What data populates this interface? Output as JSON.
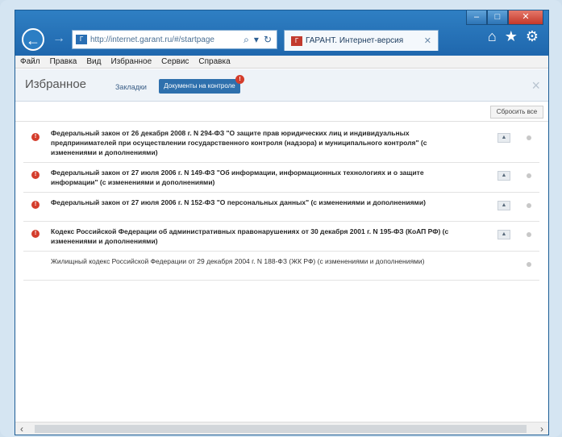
{
  "browser": {
    "address": "http://internet.garant.ru/#/startpage",
    "tab_title": "ГАРАНТ. Интернет-версия",
    "favicon": "garant-icon"
  },
  "menu": [
    "Файл",
    "Правка",
    "Вид",
    "Избранное",
    "Сервис",
    "Справка"
  ],
  "panel": {
    "title": "Избранное",
    "tab_bookmarks": "Закладки",
    "tab_control": "Документы на контроле",
    "badge": "!",
    "close": "×",
    "reset_all": "Сбросить все"
  },
  "documents": [
    {
      "text": "Федеральный закон от 26 декабря 2008 г. N 294-ФЗ \"О защите прав юридических лиц и индивидуальных предпринимателей при осуществлении государственного контроля (надзора) и муниципального контроля\" (с изменениями и дополнениями)",
      "alert": "!"
    },
    {
      "text": "Федеральный закон от 27 июля 2006 г. N 149-ФЗ \"Об информации, информационных технологиях и о защите информации\" (с изменениями и дополнениями)",
      "alert": "!"
    },
    {
      "text": "Федеральный закон от 27 июля 2006 г. N 152-ФЗ \"О персональных данных\" (с изменениями и дополнениями)",
      "alert": "!"
    },
    {
      "text": "Кодекс Российской Федерации об административных правонарушениях от 30 декабря 2001 г. N 195-ФЗ (КоАП РФ) (с изменениями и дополнениями)",
      "alert": "!"
    },
    {
      "text": "Жилищный кодекс Российской Федерации от 29 декабря 2004 г. N 188-ФЗ (ЖК РФ) (с изменениями и дополнениями)",
      "alert": ""
    }
  ],
  "colors": {
    "titlebar": "#2573b8",
    "alert": "#d43d2c",
    "active_tab": "#2e70ad"
  }
}
